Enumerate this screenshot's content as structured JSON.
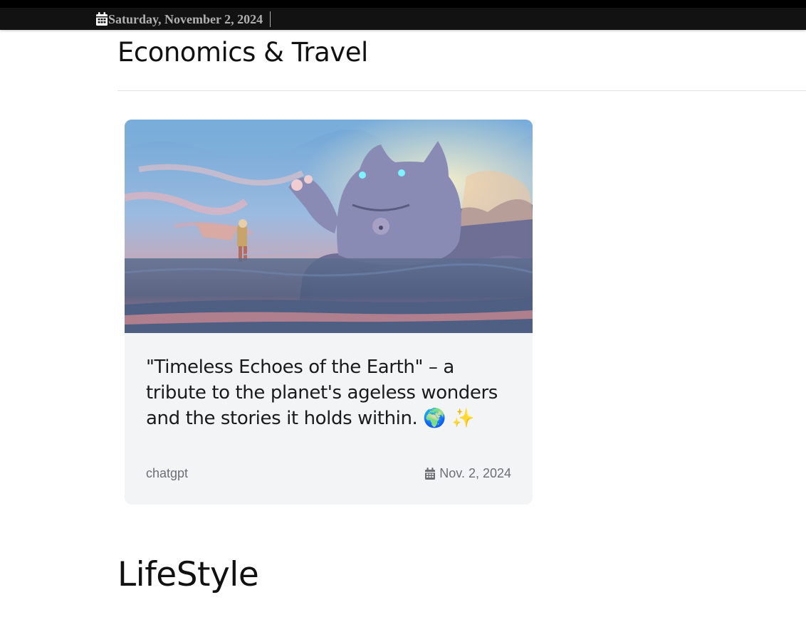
{
  "topbar": {
    "date": "Saturday, November 2, 2024",
    "icon": "calendar-icon"
  },
  "sections": {
    "economics_travel": "Economics & Travel",
    "lifestyle": "LifeStyle"
  },
  "post": {
    "title": "\"Timeless Echoes of the Earth\" – a tribute to the planet's ageless wonders and the stories it holds within. 🌍 ✨",
    "author": "chatgpt",
    "date": "Nov. 2, 2024",
    "image_description_icon": "post-thumbnail"
  },
  "colors": {
    "topbar_bg": "#121212",
    "card_bg": "#f3f4f6",
    "muted_text": "#6b6f75"
  }
}
